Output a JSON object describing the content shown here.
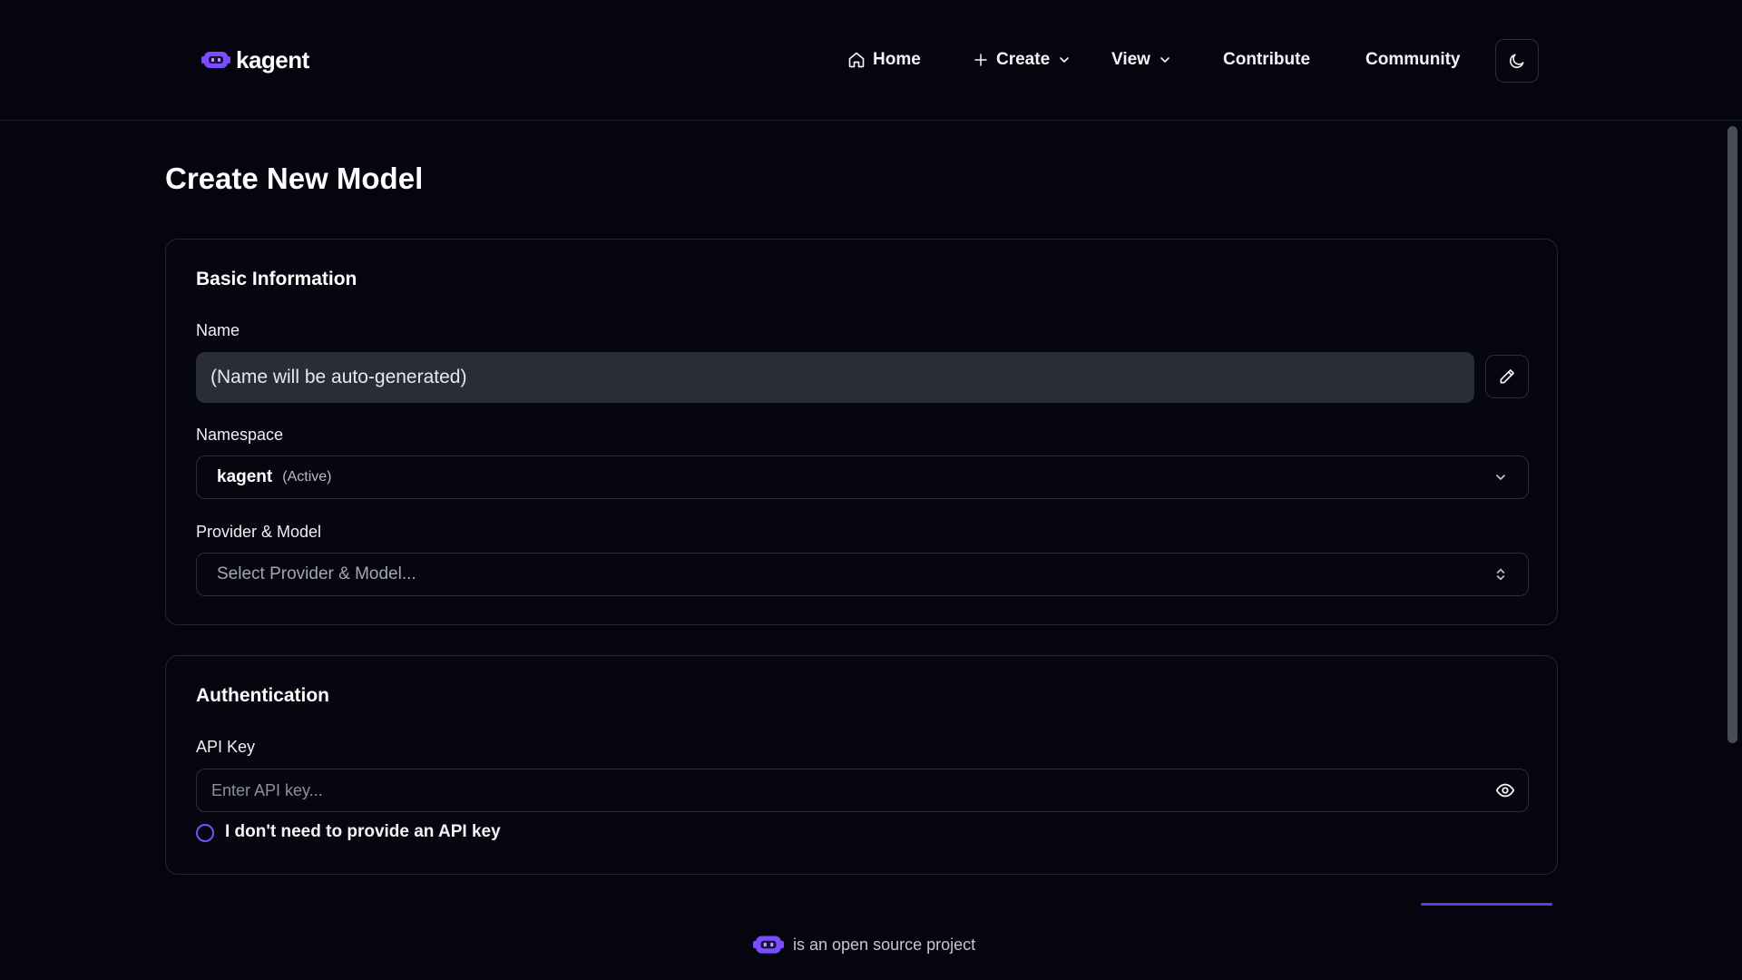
{
  "brand": {
    "name": "kagent",
    "accent": "#7c4dff"
  },
  "nav": {
    "home": "Home",
    "create": "Create",
    "view": "View",
    "contribute": "Contribute",
    "community": "Community"
  },
  "page": {
    "title": "Create New Model"
  },
  "basic_info": {
    "title": "Basic Information",
    "name_label": "Name",
    "name_value": "(Name will be auto-generated)",
    "namespace_label": "Namespace",
    "namespace_value": "kagent",
    "namespace_status": "(Active)",
    "provider_label": "Provider & Model",
    "provider_placeholder": "Select Provider & Model..."
  },
  "authentication": {
    "title": "Authentication",
    "api_key_label": "API Key",
    "api_key_placeholder": "Enter API key...",
    "no_api_key_option": "I don't need to provide an API key"
  },
  "footer": {
    "text": "is an open source project"
  },
  "icons": [
    "kagent-logo-icon",
    "home-icon",
    "plus-icon",
    "chevron-down-icon",
    "moon-icon",
    "pencil-icon",
    "chevron-up-down-icon",
    "eye-icon"
  ]
}
